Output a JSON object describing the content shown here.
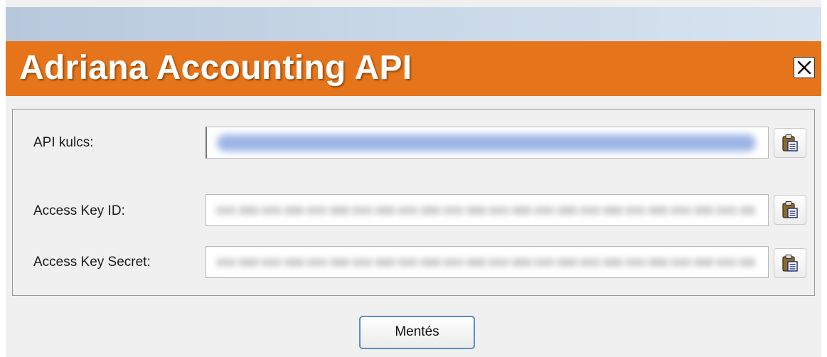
{
  "dialog": {
    "title": "Adriana Accounting API",
    "close_icon": "close-icon",
    "colors": {
      "title_bar": "#e5741a",
      "title_text": "#ffffff",
      "save_border": "#5a8dc9"
    }
  },
  "form": {
    "api_key": {
      "label": "API kulcs:",
      "value": ""
    },
    "access_key_id": {
      "label": "Access Key ID:",
      "value": ""
    },
    "access_key_secret": {
      "label": "Access Key Secret:",
      "value": ""
    },
    "paste_icon": "clipboard-paste-icon"
  },
  "actions": {
    "save_label": "Mentés"
  }
}
